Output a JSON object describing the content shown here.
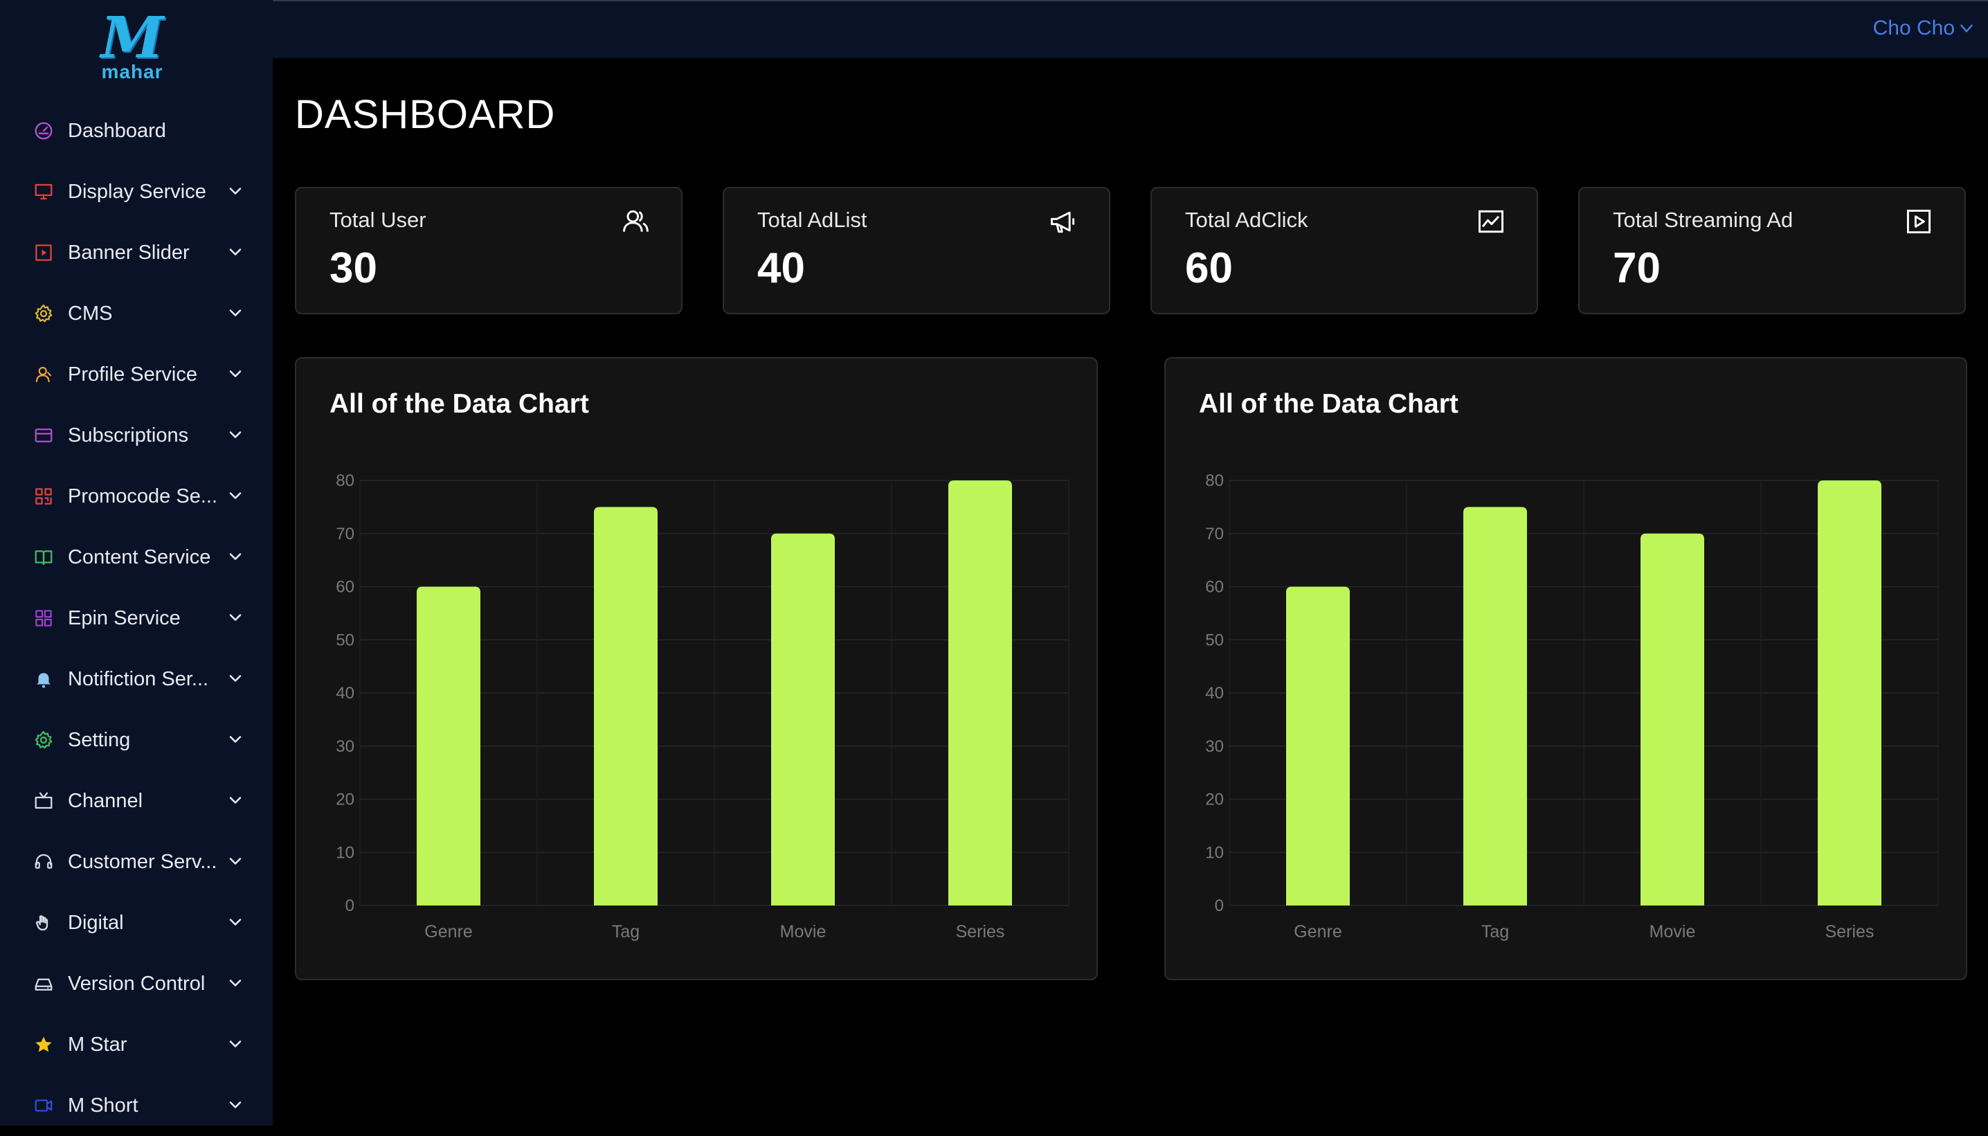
{
  "brand": {
    "logo_mark": "M",
    "logo_text": "mahar"
  },
  "sidebar": {
    "items": [
      {
        "label": "Dashboard",
        "icon": "gauge-icon",
        "color": "#c14fd8",
        "has_submenu": false
      },
      {
        "label": "Display Service",
        "icon": "monitor-icon",
        "color": "#e0443a",
        "has_submenu": true
      },
      {
        "label": "Banner Slider",
        "icon": "play-square-icon",
        "color": "#e0443a",
        "has_submenu": true
      },
      {
        "label": "CMS",
        "icon": "gear-icon",
        "color": "#e2b72a",
        "has_submenu": true
      },
      {
        "label": "Profile Service",
        "icon": "user-icon",
        "color": "#f0a03c",
        "has_submenu": true
      },
      {
        "label": "Subscriptions",
        "icon": "card-icon",
        "color": "#b44fd0",
        "has_submenu": true
      },
      {
        "label": "Promocode Se...",
        "icon": "qr-icon",
        "color": "#e0443a",
        "has_submenu": true
      },
      {
        "label": "Content Service",
        "icon": "book-icon",
        "color": "#3fbf5c",
        "has_submenu": true
      },
      {
        "label": "Epin Service",
        "icon": "grid-icon",
        "color": "#9a3fcf",
        "has_submenu": true
      },
      {
        "label": "Notifiction Ser...",
        "icon": "bell-icon",
        "color": "#8fc6f0",
        "has_submenu": true
      },
      {
        "label": "Setting",
        "icon": "gear-icon",
        "color": "#3fbf5c",
        "has_submenu": true
      },
      {
        "label": "Channel",
        "icon": "tv-icon",
        "color": "#d8dce6",
        "has_submenu": true
      },
      {
        "label": "Customer Serv...",
        "icon": "headset-icon",
        "color": "#d8dce6",
        "has_submenu": true
      },
      {
        "label": "Digital",
        "icon": "hand-icon",
        "color": "#d8dce6",
        "has_submenu": true
      },
      {
        "label": "Version Control",
        "icon": "drive-icon",
        "color": "#d8dce6",
        "has_submenu": true
      },
      {
        "label": "M Star",
        "icon": "star-icon",
        "color": "#f5c518",
        "has_submenu": true
      },
      {
        "label": "M Short",
        "icon": "video-icon",
        "color": "#2f4de0",
        "has_submenu": true
      }
    ]
  },
  "header": {
    "user_name": "Cho Cho"
  },
  "page": {
    "title": "DASHBOARD"
  },
  "stats": [
    {
      "label": "Total User",
      "value": "30",
      "icon": "users-icon"
    },
    {
      "label": "Total AdList",
      "value": "40",
      "icon": "megaphone-icon"
    },
    {
      "label": "Total AdClick",
      "value": "60",
      "icon": "line-chart-icon"
    },
    {
      "label": "Total Streaming Ad",
      "value": "70",
      "icon": "play-icon"
    }
  ],
  "chart_data": [
    {
      "type": "bar",
      "title": "All of the Data Chart",
      "categories": [
        "Genre",
        "Tag",
        "Movie",
        "Series"
      ],
      "values": [
        60,
        75,
        70,
        80
      ],
      "ylim": [
        0,
        80
      ],
      "yticks": [
        0,
        10,
        20,
        30,
        40,
        50,
        60,
        70,
        80
      ],
      "grid": true,
      "bar_color": "#bef65a"
    },
    {
      "type": "bar",
      "title": "All of the Data Chart",
      "categories": [
        "Genre",
        "Tag",
        "Movie",
        "Series"
      ],
      "values": [
        60,
        75,
        70,
        80
      ],
      "ylim": [
        0,
        80
      ],
      "yticks": [
        0,
        10,
        20,
        30,
        40,
        50,
        60,
        70,
        80
      ],
      "grid": true,
      "bar_color": "#bef65a"
    }
  ]
}
